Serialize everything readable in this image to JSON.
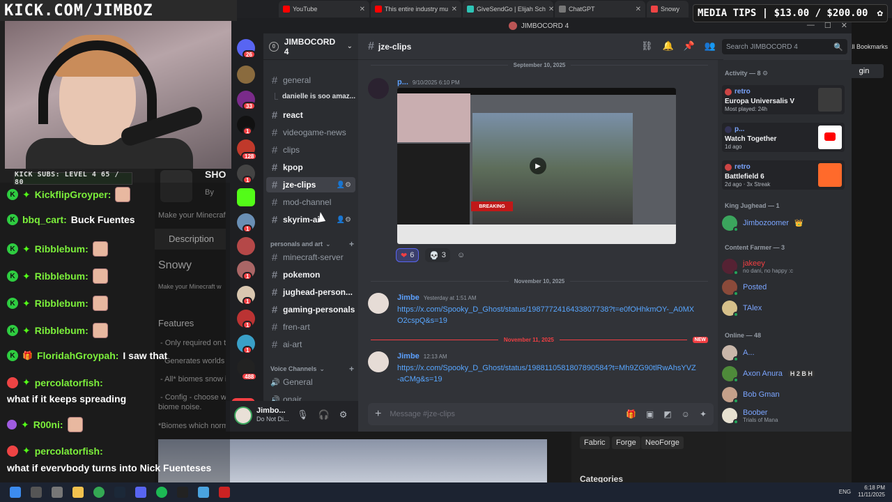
{
  "overlay": {
    "kick_banner": "KICK.COM/JIMBOZ",
    "kick_subs": "KICK SUBS: LEVEL 4 65 / 80",
    "media_tips": "MEDIA TIPS | $13.00 / $200.00"
  },
  "browser": {
    "tabs": [
      {
        "label": "YouTube",
        "color": "#ff0000"
      },
      {
        "label": "This entire industry mu",
        "color": "#ff0000"
      },
      {
        "label": "GiveSendGo | Elijah Sch",
        "color": "#2ec4b6"
      },
      {
        "label": "ChatGPT",
        "color": "#777777"
      },
      {
        "label": "Snowy",
        "color": "#e44"
      }
    ],
    "bookmarks_label": "All Bookmarks",
    "login_label": "gin"
  },
  "chat": [
    {
      "user": "KickflipGroyper:",
      "msg": "",
      "badge": "kick"
    },
    {
      "user": "bbq_cart:",
      "msg": "Buck Fuentes",
      "badge": "kick"
    },
    {
      "user": "Ribblebum:",
      "msg": "",
      "badge": "kick"
    },
    {
      "user": "Ribblebum:",
      "msg": "",
      "badge": "kick"
    },
    {
      "user": "Ribblebum:",
      "msg": "",
      "badge": "kick"
    },
    {
      "user": "Ribblebum:",
      "msg": "",
      "badge": "kick"
    },
    {
      "user": "FloridahGroypah:",
      "msg": "I saw that",
      "badge": "kick"
    },
    {
      "user": "percolatorfish:",
      "msg": "",
      "badge": "red"
    },
    {
      "user": "R00ni:",
      "msg": "",
      "badge": "purple"
    },
    {
      "user": "percolatorfish:",
      "msg": "",
      "badge": "red"
    }
  ],
  "chat_wraps": [
    "what if it keeps spreading",
    "what if evervbody turns into Nick Fuenteses"
  ],
  "modpage": {
    "by": "By",
    "short_desc": "Make your Minecraft",
    "description_tab": "Description",
    "title": "Snowy",
    "short_desc_2": "Make your Minecraft w",
    "features": "Features",
    "lines": [
      "- Only required on t",
      "Generates worlds w",
      "- All* biomes snow in",
      "- Config - choose wh",
      "biome noise.",
      "*Biomes which norm"
    ],
    "tags": [
      "Fabric",
      "Forge",
      "NeoForge"
    ],
    "categories": "Categories",
    "sho": "SHO"
  },
  "discord": {
    "window_title": "JIMBOCORD 4",
    "server_name": "JIMBOCORD 4",
    "server_level": "0",
    "rail_badges": [
      "26",
      "33",
      "1",
      "128",
      "1",
      "1",
      "1",
      "1",
      "1",
      "1",
      "1",
      "1",
      "488"
    ],
    "rail_new": "NEW",
    "channels": [
      {
        "name": "general",
        "type": "text",
        "bold": false
      },
      {
        "name": "react",
        "type": "text",
        "bold": true
      },
      {
        "name": "videogame-news",
        "type": "text",
        "bold": false
      },
      {
        "name": "clips",
        "type": "text",
        "bold": false
      },
      {
        "name": "kpop",
        "type": "text",
        "bold": true
      },
      {
        "name": "jze-clips",
        "type": "text",
        "bold": true,
        "active": true
      },
      {
        "name": "mod-channel",
        "type": "text",
        "bold": false
      },
      {
        "name": "skyrim-ai",
        "type": "text",
        "bold": true
      },
      {
        "name": "minecraft-server",
        "type": "text",
        "bold": false
      },
      {
        "name": "pokemon",
        "type": "text",
        "bold": true
      },
      {
        "name": "jughead-person...",
        "type": "text",
        "bold": true
      },
      {
        "name": "gaming-personals",
        "type": "text",
        "bold": true
      },
      {
        "name": "fren-art",
        "type": "text",
        "bold": false
      },
      {
        "name": "ai-art",
        "type": "text",
        "bold": false
      },
      {
        "name": "General",
        "type": "voice",
        "bold": false
      },
      {
        "name": "onair",
        "type": "voice",
        "bold": false
      }
    ],
    "thread": "danielle is soo amaz...",
    "category_personals": "personals and art",
    "category_voice": "Voice Channels",
    "user_panel": {
      "name": "Jimbo...",
      "status": "Do Not Di..."
    },
    "header_channel": "jze-clips",
    "search_placeholder": "Search JIMBOCORD 4",
    "messages": {
      "date1": "September 10, 2025",
      "msg1_author": "p...",
      "msg1_time": "9/10/2025 6:10 PM",
      "reactions": [
        {
          "emoji": "❤",
          "count": "6"
        },
        {
          "emoji": "💀",
          "count": "3"
        }
      ],
      "date2": "November 10, 2025",
      "msg2_author": "Jimbe",
      "msg2_time": "Yesterday at 1:51 AM",
      "msg2_link": "https://x.com/Spooky_D_Ghost/status/1987772416433807738?t=e0fOHhkmOY-_A0MXO2cspQ&s=19",
      "date3": "November 11, 2025",
      "new_label": "NEW",
      "msg3_author": "Jimbe",
      "msg3_time": "12:13 AM",
      "msg3_link": "https://x.com/Spooky_D_Ghost/status/1988110581807890584?t=Mh9ZG90tlRwAhsYVZ-aCMg&s=19",
      "embed_breaking": "BREAKING"
    },
    "composer_placeholder": "Message #jze-clips",
    "members": {
      "activity_header": "Activity — 8",
      "activities": [
        {
          "user": "retro",
          "title": "Europa Universalis V",
          "sub": "Most played: 24h",
          "art_color": "#3b3b3b"
        },
        {
          "user": "p...",
          "title": "Watch Together",
          "sub": "1d ago",
          "art_color": "#ffffff"
        },
        {
          "user": "retro",
          "title": "Battlefield 6",
          "sub": "2d ago  ⋅  3x Streak",
          "art_color": "#ff6a2b"
        }
      ],
      "role1_header": "King Jughead — 1",
      "role1_members": [
        {
          "name": "Jimbozoomer",
          "sub": ""
        }
      ],
      "role2_header": "Content Farmer — 3",
      "role2_members": [
        {
          "name": "jakeey",
          "sub": "no dani, no happy :c"
        },
        {
          "name": "Posted",
          "sub": ""
        },
        {
          "name": "TAlex",
          "sub": ""
        }
      ],
      "online_header": "Online — 48",
      "online_members": [
        {
          "name": "A...",
          "sub": ""
        },
        {
          "name": "Axon Anura",
          "sub": ""
        },
        {
          "name": "Bob Gman",
          "sub": ""
        },
        {
          "name": "Boober",
          "sub": "Trials of Mana"
        }
      ],
      "axon_tag": "H 2 B H"
    }
  },
  "taskbar": {
    "lang": "ENG",
    "time": "6:18 PM",
    "date": "11/11/2025"
  }
}
